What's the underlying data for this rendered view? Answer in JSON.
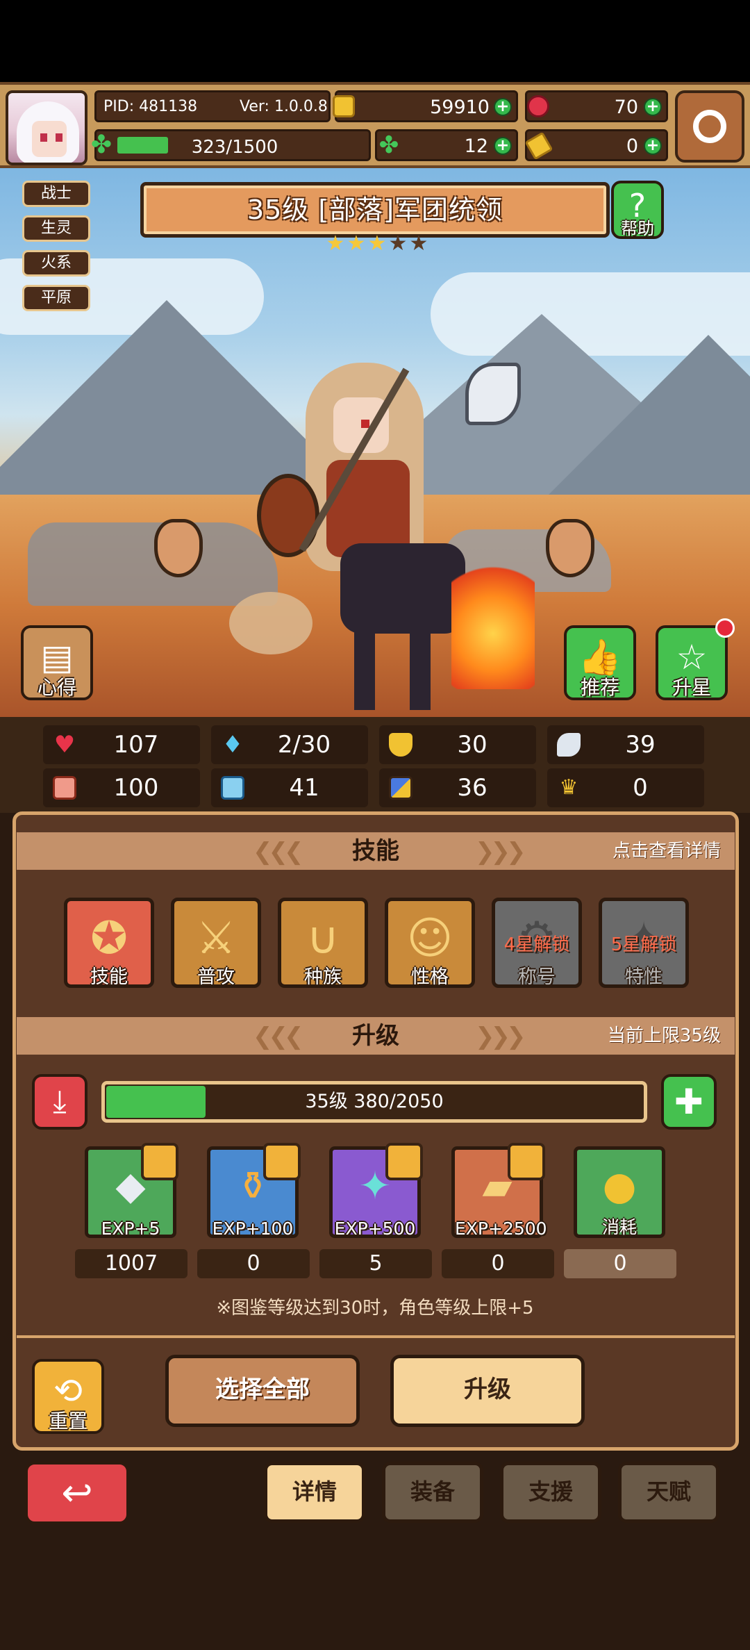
{
  "player": {
    "pid": "PID: 481138",
    "version": "Ver: 1.0.0.8",
    "energy": "323/1500",
    "energy_fraction": 0.215
  },
  "currencies": {
    "gold": "59910",
    "gems": "70",
    "clover": "12",
    "tickets": "0"
  },
  "hero": {
    "title": "35级 [部落]军团统领",
    "stars_filled": 3,
    "stars_total": 5,
    "tags": [
      "战士",
      "生灵",
      "火系",
      "平原"
    ]
  },
  "buttons": {
    "help": "帮助",
    "insight": "心得",
    "recommend": "推荐",
    "star_up": "升星"
  },
  "stats": {
    "hp": "107",
    "mana": "2/30",
    "defense": "30",
    "wing": "39",
    "attack": "100",
    "book": "41",
    "speed": "36",
    "crown": "0"
  },
  "skills_section": {
    "title": "技能",
    "hint": "点击查看详情",
    "items": [
      {
        "label": "技能",
        "lock": ""
      },
      {
        "label": "普攻",
        "lock": ""
      },
      {
        "label": "种族",
        "lock": ""
      },
      {
        "label": "性格",
        "lock": ""
      },
      {
        "label": "称号",
        "lock": "4星解锁"
      },
      {
        "label": "特性",
        "lock": "5星解锁"
      }
    ]
  },
  "upgrade_section": {
    "title": "升级",
    "hint": "当前上限35级",
    "xp_text": "35级  380/2050",
    "xp_fraction": 0.185,
    "items": [
      {
        "label": "EXP+5",
        "count": "1007"
      },
      {
        "label": "EXP+100",
        "count": "0"
      },
      {
        "label": "EXP+500",
        "count": "5"
      },
      {
        "label": "EXP+2500",
        "count": "0"
      },
      {
        "label": "消耗",
        "count": "0"
      }
    ],
    "note": "※图鉴等级达到30时，角色等级上限+5"
  },
  "actions": {
    "reset": "重置",
    "select_all": "选择全部",
    "upgrade": "升级"
  },
  "tabs": [
    "详情",
    "装备",
    "支援",
    "天赋"
  ],
  "colors": {
    "accent_green": "#45c14f",
    "panel_brown": "#5a3825",
    "title_orange": "#e49a5e",
    "back_red": "#e0444a"
  }
}
